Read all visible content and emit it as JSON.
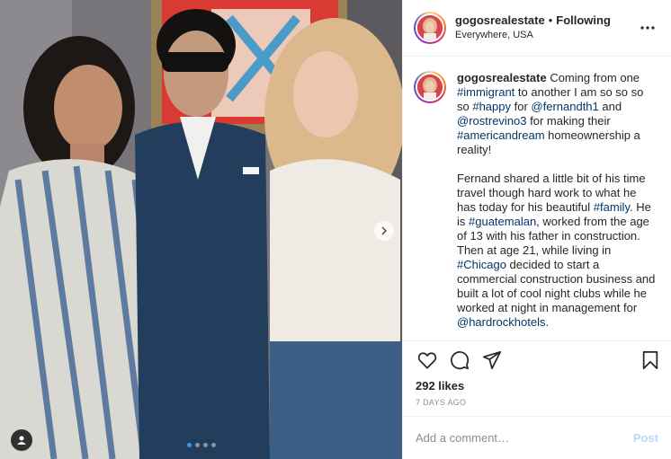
{
  "header": {
    "username": "gogosrealestate",
    "separator": "•",
    "follow_state": "Following",
    "location": "Everywhere, USA",
    "more_icon": "more-horizontal-icon"
  },
  "caption": {
    "username": "gogosrealestate",
    "p1": {
      "t1": " Coming from one ",
      "tag1": "#immigrant",
      "t2": " to another I am so so so so ",
      "tag2": "#happy",
      "t3": " for ",
      "tag3": "@fernandth1",
      "t4": " and ",
      "tag4": "@rostrevino3",
      "t5": " for making their ",
      "tag5": "#americandream",
      "t6": " homeownership a reality!"
    },
    "p2": {
      "t1": "Fernand shared a little bit of his time travel though hard work to what he has today for his beautiful ",
      "tag1": "#family",
      "t2": ". He is ",
      "tag2": "#guatemalan",
      "t3": ", worked from the age of 13 with his father in construction. Then at age 21, while living in ",
      "tag3": "#Chicago",
      "t4": " decided to start a commercial construction business and built a lot of cool night clubs while he worked at night in management for ",
      "tag4": "@hardrockhotels",
      "t5": "."
    }
  },
  "actions": {
    "icons": [
      "heart-icon",
      "comment-icon",
      "share-icon",
      "bookmark-icon"
    ],
    "likes": "292 likes",
    "timestamp": "7 DAYS AGO"
  },
  "comment": {
    "placeholder": "Add a comment…",
    "post_label": "Post"
  },
  "carousel": {
    "slides": 4,
    "active": 0
  },
  "colors": {
    "link": "#00376b",
    "post_disabled": "#b3dbff",
    "active_dot": "#3897f0"
  }
}
